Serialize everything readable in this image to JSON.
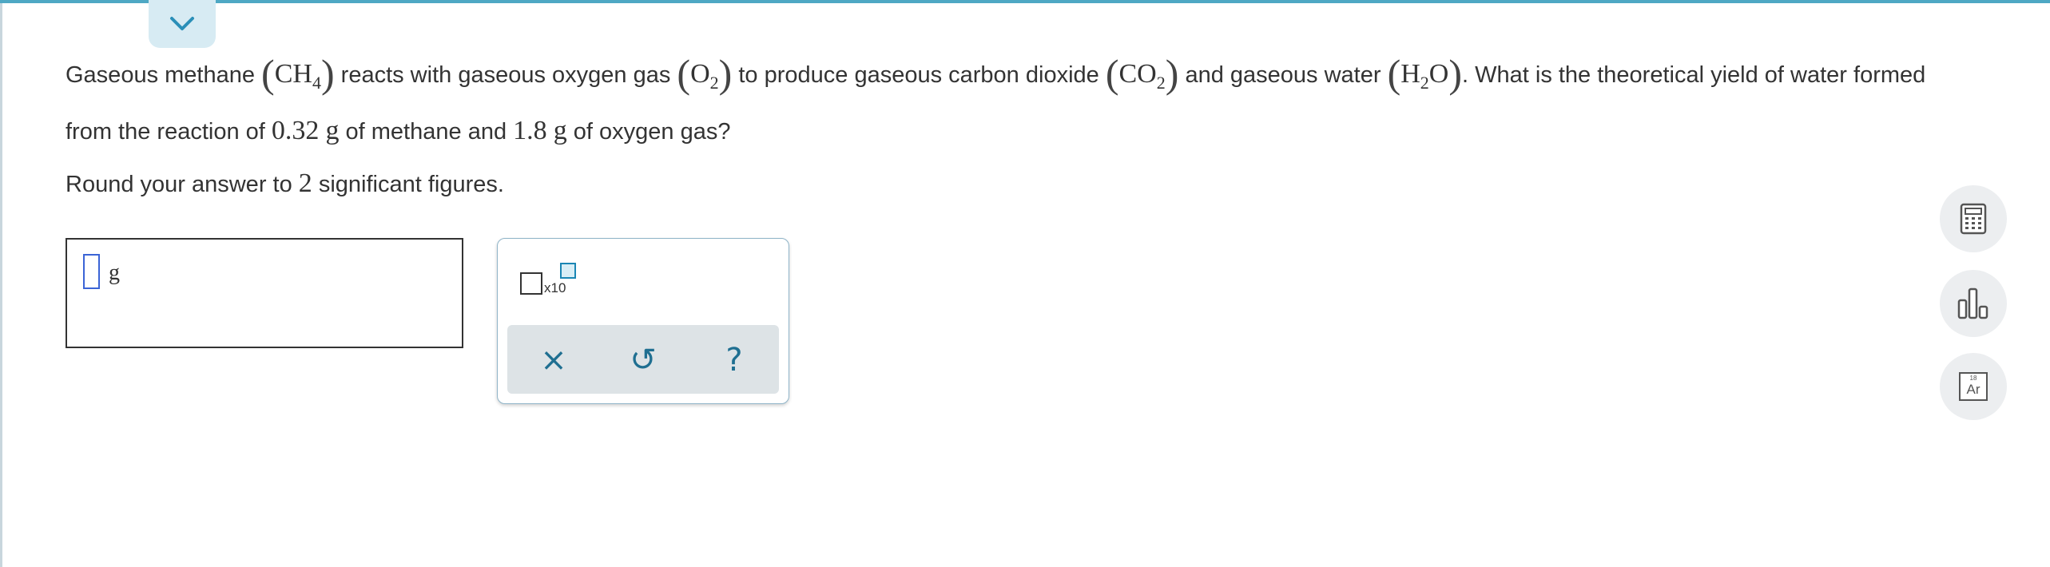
{
  "question": {
    "p1": "Gaseous methane",
    "methane_formula": [
      "CH",
      "4"
    ],
    "p2": "reacts with gaseous oxygen gas",
    "oxygen_formula": [
      "O",
      "2"
    ],
    "p3": "to produce gaseous carbon dioxide",
    "co2_formula": [
      "CO",
      "2"
    ],
    "p4": "and gaseous water",
    "water_formula": [
      "H",
      "2",
      "O"
    ],
    "p5": ". What is the theoretical yield of water formed from the reaction of",
    "methane_mass": "0.32",
    "unit_g": "g",
    "p6": "of methane and",
    "oxygen_mass": "1.8",
    "p7": "of oxygen gas?"
  },
  "instruction": {
    "prefix": "Round your answer to",
    "sig_figs": "2",
    "suffix": "significant figures."
  },
  "answer": {
    "value": "",
    "unit": "g"
  },
  "palette": {
    "sci_label": "x10",
    "clear_symbol": "×",
    "undo_symbol": "↺",
    "help_symbol": "?"
  },
  "tools": {
    "periodic_number": "18",
    "periodic_symbol": "Ar"
  },
  "icons": [
    "chevron-down-icon",
    "calculator-icon",
    "bar-chart-icon",
    "periodic-table-icon",
    "clear-icon",
    "undo-icon",
    "help-icon"
  ],
  "colors": {
    "accent": "#4ea8c4",
    "cursor": "#3b64d6",
    "action": "#1f6f91"
  }
}
